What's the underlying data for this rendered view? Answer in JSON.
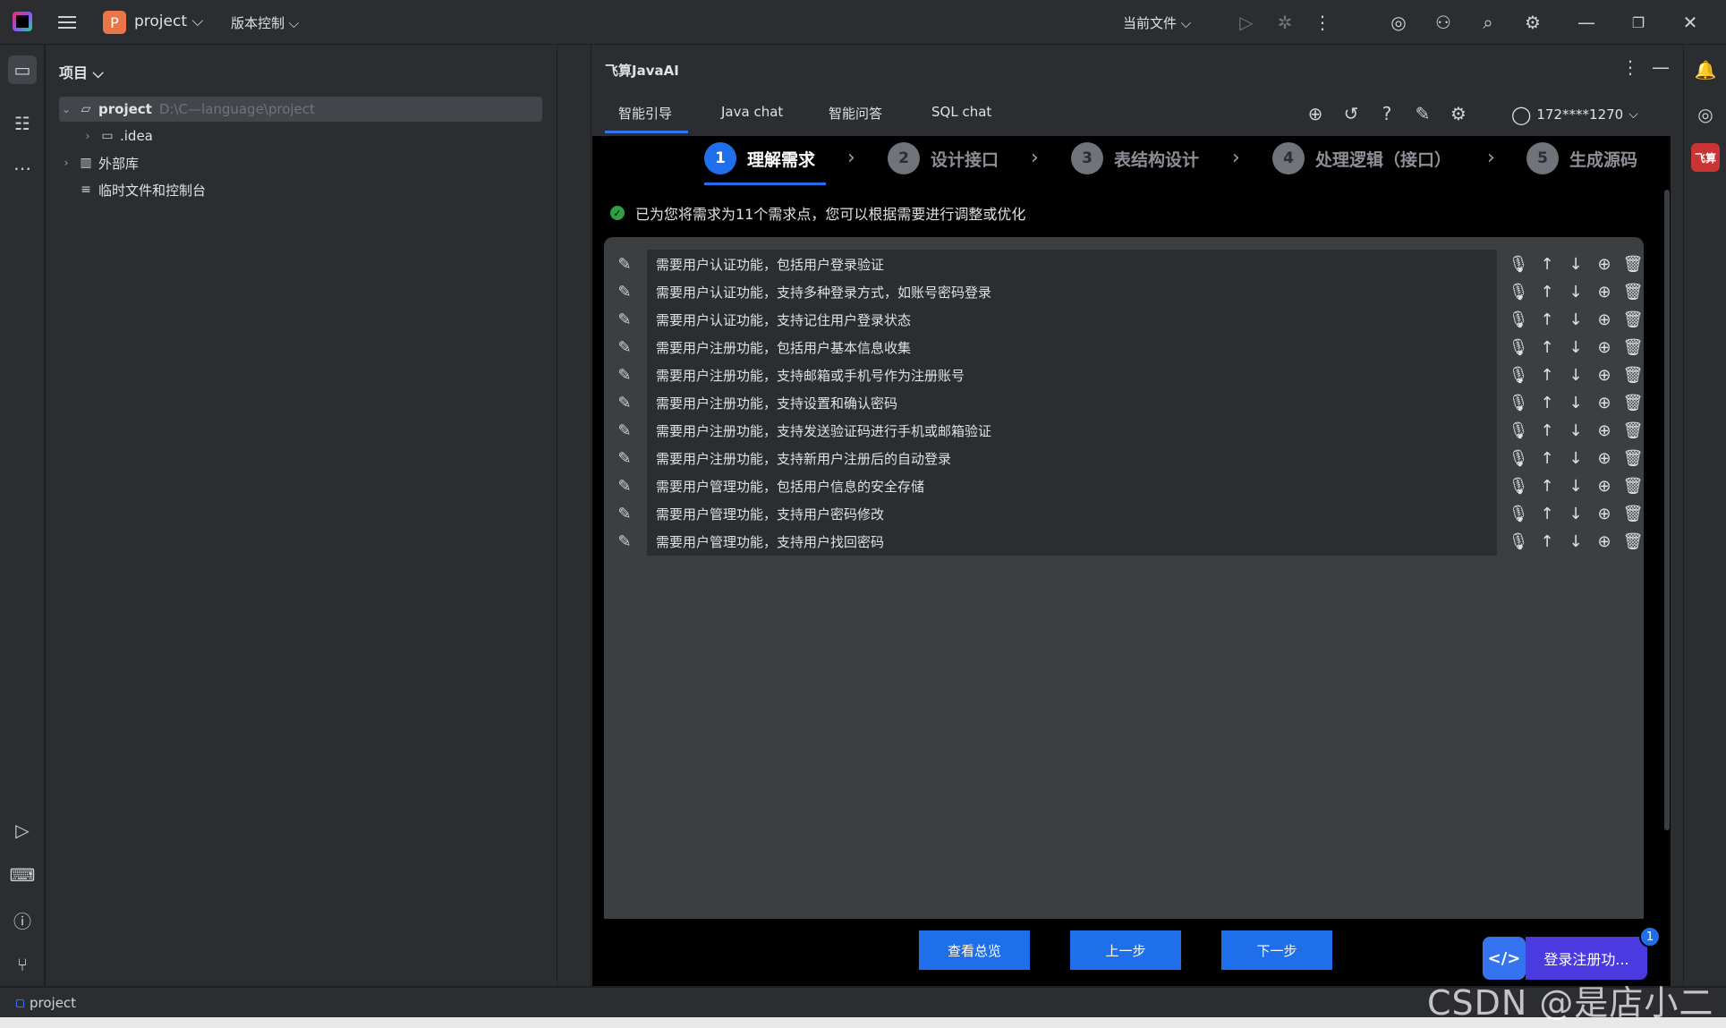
{
  "titlebar": {
    "project_badge": "P",
    "project_name": "project ⌵",
    "vcs_menu": "版本控制 ⌵",
    "current_file": "当前文件 ⌵"
  },
  "project_panel": {
    "header": "项目 ⌵",
    "tree": [
      {
        "label": "project",
        "path": "D:\\C—language\\project"
      },
      {
        "label": ".idea"
      },
      {
        "label": "外部库"
      },
      {
        "label": "临时文件和控制台"
      }
    ]
  },
  "ai_panel": {
    "title": "飞算JavaAI",
    "tabs": [
      "智能引导",
      "Java chat",
      "智能问答",
      "SQL chat"
    ],
    "user": "172****1270",
    "steps": [
      {
        "num": "1",
        "label": "理解需求"
      },
      {
        "num": "2",
        "label": "设计接口"
      },
      {
        "num": "3",
        "label": "表结构设计"
      },
      {
        "num": "4",
        "label": "处理逻辑（接口）"
      },
      {
        "num": "5",
        "label": "生成源码"
      }
    ],
    "notice": "已为您将需求为11个需求点，您可以根据需要进行调整或优化",
    "requirements": [
      "需要用户认证功能，包括用户登录验证",
      "需要用户认证功能，支持多种登录方式，如账号密码登录",
      "需要用户认证功能，支持记住用户登录状态",
      "需要用户注册功能，包括用户基本信息收集",
      "需要用户注册功能，支持邮箱或手机号作为注册账号",
      "需要用户注册功能，支持设置和确认密码",
      "需要用户注册功能，支持发送验证码进行手机或邮箱验证",
      "需要用户注册功能，支持新用户注册后的自动登录",
      "需要用户管理功能，包括用户信息的安全存储",
      "需要用户管理功能，支持用户密码修改",
      "需要用户管理功能，支持用户找回密码"
    ],
    "buttons": {
      "overview": "查看总览",
      "prev": "上一步",
      "next": "下一步"
    }
  },
  "floating_widget": {
    "label": "登录注册功...",
    "badge": "1",
    "icon_text": "</>"
  },
  "statusbar": {
    "project": "project"
  },
  "watermark": "CSDN @是店小二呀",
  "right_strip": {
    "feisuan_label": "飞算"
  },
  "colors": {
    "accent": "#1f6feb",
    "panel": "#2b2d30",
    "content_bg": "#000000",
    "req_box": "#3c3f41"
  }
}
